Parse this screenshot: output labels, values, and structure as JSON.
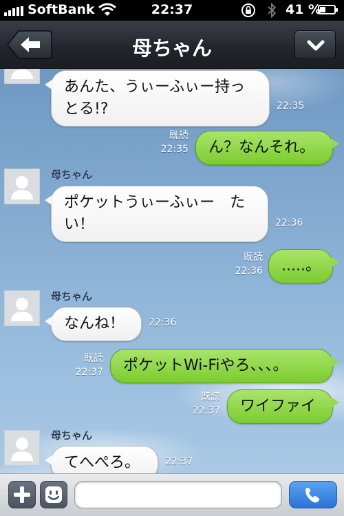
{
  "status_bar": {
    "carrier": "SoftBank",
    "time": "22:37",
    "battery_percent_label": "41 %",
    "battery_level": 0.41
  },
  "nav": {
    "title": "母ちゃん"
  },
  "messages": [
    {
      "type": "in",
      "lines": [
        "あんた、うぃーふぃー持っ",
        "とる!?"
      ],
      "time": "22:35"
    },
    {
      "type": "out",
      "text": "ん？なんそれ。",
      "read": "既読",
      "time": "22:35"
    },
    {
      "type": "in",
      "sender": "母ちゃん",
      "lines": [
        "ポケットうぃーふぃー　た",
        "い！"
      ],
      "time": "22:36"
    },
    {
      "type": "out",
      "text": ".....。",
      "read": "既読",
      "time": "22:36"
    },
    {
      "type": "in",
      "sender": "母ちゃん",
      "text": "なんね！",
      "time": "22:36"
    },
    {
      "type": "out",
      "text": "ポケットWi-Fiやろ、、、。",
      "read": "既読",
      "time": "22:37"
    },
    {
      "type": "out",
      "text": "ワイファイ",
      "read": "既読",
      "time": "22:37"
    },
    {
      "type": "in",
      "sender": "母ちゃん",
      "text": "てへぺろ。",
      "time": "22:37"
    }
  ],
  "input_bar": {
    "add_icon": "plus-icon",
    "sticker_icon": "smiley-icon",
    "call_icon": "phone-icon",
    "message_value": ""
  },
  "colors": {
    "outgoing_bubble": "#8fd645",
    "incoming_bubble": "#ffffff",
    "nav_bar": "#262a31",
    "call_button": "#3b86e4"
  }
}
